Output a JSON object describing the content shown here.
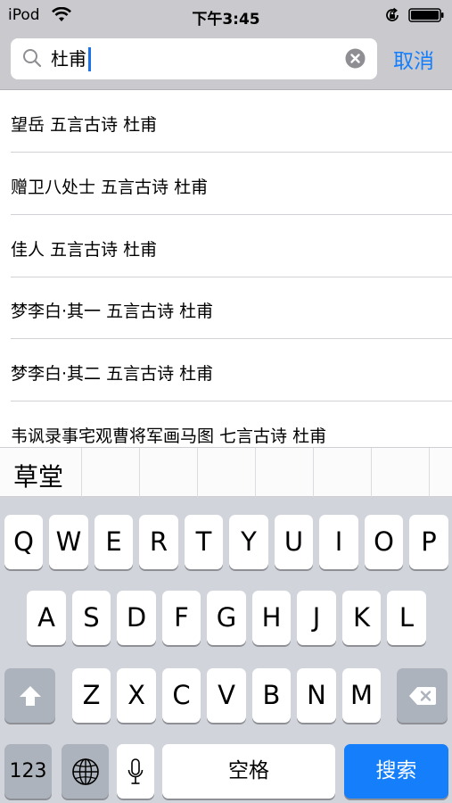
{
  "status_bar": {
    "carrier": "iPod",
    "time": "下午3:45",
    "icons": [
      "wifi-icon",
      "rotation-lock-icon",
      "battery-icon"
    ]
  },
  "search": {
    "value": "杜甫",
    "cancel_label": "取消",
    "icons": [
      "search-icon",
      "clear-icon"
    ]
  },
  "results": [
    {
      "label": "望岳 五言古诗 杜甫"
    },
    {
      "label": "赠卫八处士 五言古诗 杜甫"
    },
    {
      "label": "佳人 五言古诗 杜甫"
    },
    {
      "label": "梦李白·其一 五言古诗 杜甫"
    },
    {
      "label": "梦李白·其二 五言古诗 杜甫"
    },
    {
      "label": "韦讽录事宅观曹将军画马图 七言古诗 杜甫"
    }
  ],
  "candidate_bar": {
    "candidate": "草堂"
  },
  "keyboard": {
    "row1": [
      "Q",
      "W",
      "E",
      "R",
      "T",
      "Y",
      "U",
      "I",
      "O",
      "P"
    ],
    "row2": [
      "A",
      "S",
      "D",
      "F",
      "G",
      "H",
      "J",
      "K",
      "L"
    ],
    "row3": [
      "Z",
      "X",
      "C",
      "V",
      "B",
      "N",
      "M"
    ],
    "numbers_label": "123",
    "space_label": "空格",
    "search_label": "搜索",
    "icons": [
      "shift-icon",
      "delete-icon",
      "globe-icon",
      "microphone-icon"
    ]
  },
  "colors": {
    "accent": "#147efb",
    "keyboard_bg": "#d1d5db",
    "search_bar_bg": "#c9c9ce"
  }
}
